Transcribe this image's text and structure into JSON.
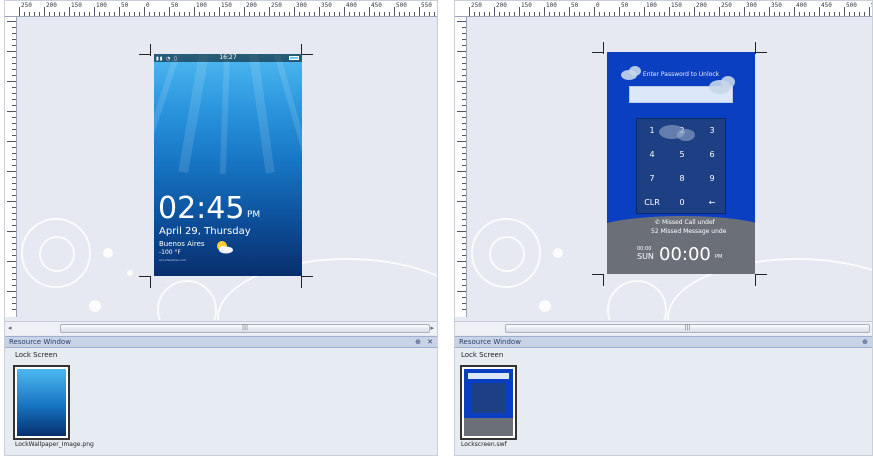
{
  "ruler": {
    "labels": [
      "250",
      "200",
      "150",
      "100",
      "50",
      "0",
      "50",
      "100",
      "150",
      "200",
      "250",
      "300",
      "350",
      "400",
      "450",
      "500",
      "550"
    ]
  },
  "left": {
    "phone": {
      "status_time": "16:27",
      "time": "02:45",
      "ampm": "PM",
      "date": "April 29, Thursday",
      "city": "Buenos Aires",
      "temp": "-100 °F",
      "credit": "AccuWeather.com"
    },
    "resource": {
      "title": "Resource Window",
      "group": "Lock Screen",
      "pin": "⊕",
      "close": "✕",
      "caption": "LockWallpaper_Image.png"
    },
    "scroll_grip": "|||"
  },
  "right": {
    "phone": {
      "prompt": "Enter Password to Unlock",
      "keys": [
        "1",
        "2",
        "3",
        "4",
        "5",
        "6",
        "7",
        "8",
        "9",
        "CLR",
        "0",
        "←"
      ],
      "missed_call": "Missed Call",
      "missed_call_value": "undef",
      "missed_msg": "Missed Message",
      "missed_msg_value": "unde",
      "missed_msg_count": "52",
      "date_small": "00:00",
      "day": "SUN",
      "time": "00:00",
      "ampm": "PM"
    },
    "resource": {
      "title": "Resource Window",
      "group": "Lock Screen",
      "pin": "⊕",
      "caption": "Lockscreen.swf"
    },
    "scroll_grip": "|||"
  },
  "colors": {
    "panel_bg": "#e6eaf2",
    "resource_header": "#c9d3e6",
    "keypad_bg": "#1d3f83",
    "lock_blue": "#0b3fc2"
  }
}
